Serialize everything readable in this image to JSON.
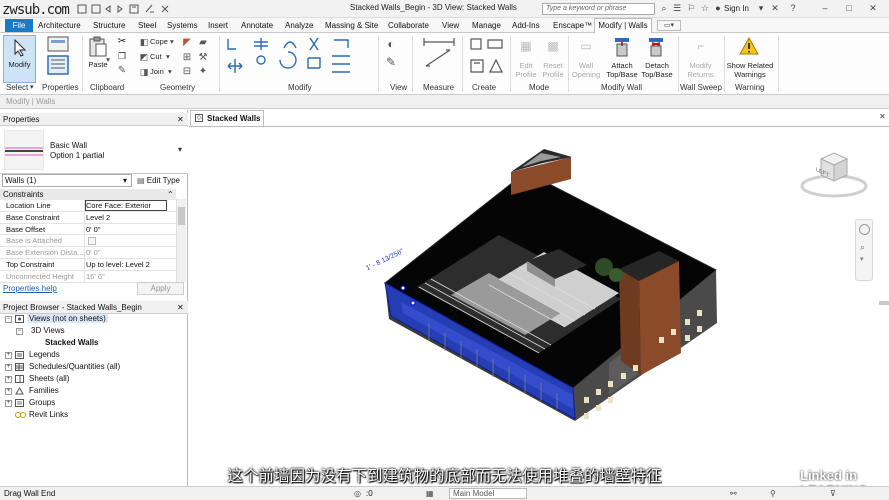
{
  "watermark": "zwsub.com",
  "titlebar": {
    "document_title": "Stacked Walls_Begin - 3D View: Stacked Walls",
    "search_placeholder": "Type a keyword or phrase",
    "sign_in": "Sign In"
  },
  "menu": {
    "tabs": [
      "File",
      "Architecture",
      "Structure",
      "Steel",
      "Systems",
      "Insert",
      "Annotate",
      "Analyze",
      "Massing & Site",
      "Collaborate",
      "View",
      "Manage",
      "Add-Ins",
      "Enscape™",
      "Modify | Walls"
    ]
  },
  "ribbon": {
    "modify_label": "Modify",
    "paste_label": "Paste",
    "clipboard_items": [
      "Cope",
      "Cut",
      "Join"
    ],
    "edit_profile": "Edit Profile",
    "reset_profile": "Reset Profile",
    "wall_opening": "Wall Opening",
    "attach_top_base": "Attach Top/Base",
    "detach_top_base": "Detach Top/Base",
    "modify_returns": "Modify Returns",
    "show_related_warnings": "Show Related Warnings",
    "groups": [
      "Select",
      "Properties",
      "Clipboard",
      "Geometry",
      "Modify",
      "View",
      "Measure",
      "Create",
      "Mode",
      "Modify Wall",
      "Wall Sweep",
      "Warning"
    ]
  },
  "selectbar": {
    "text": "Modify | Walls"
  },
  "properties": {
    "header": "Properties",
    "family": "Basic Wall",
    "type": "Option 1 partial",
    "selector": "Walls (1)",
    "edit_type": "Edit Type",
    "section": "Constraints",
    "rows": [
      {
        "key": "Location Line",
        "value": "Core Face: Exterior"
      },
      {
        "key": "Base Constraint",
        "value": "Level 2"
      },
      {
        "key": "Base Offset",
        "value": "0'  0\""
      },
      {
        "key": "Base is Attached",
        "value": ""
      },
      {
        "key": "Base Extension Dista...",
        "value": "0'  0\""
      },
      {
        "key": "Top Constraint",
        "value": "Up to level: Level 2"
      },
      {
        "key": "Unconnected Height",
        "value": "16'  6\""
      }
    ],
    "help_link": "Properties help",
    "apply": "Apply"
  },
  "browser": {
    "header": "Project Browser - Stacked Walls_Begin",
    "items": [
      "Views (not on sheets)",
      "3D Views",
      "Stacked Walls",
      "Legends",
      "Schedules/Quantities (all)",
      "Sheets (all)",
      "Families",
      "Groups",
      "Revit Links"
    ]
  },
  "view": {
    "tab_label": "Stacked Walls",
    "cube_label": "LEFT",
    "temp_dimension": "1' - 8 13/256\""
  },
  "status": {
    "left": "Drag Wall End",
    "model": "Main Model",
    "coord": ":0"
  },
  "subtitle": "这个前墙因为没有下到建筑物的底部而无法使用堆叠的墙壁特征",
  "branding": "Linked in LEARNING",
  "colors": {
    "file_tab": "#1979ca",
    "selection_blue": "#1f3fd6",
    "brick": "#8b4a2a"
  }
}
